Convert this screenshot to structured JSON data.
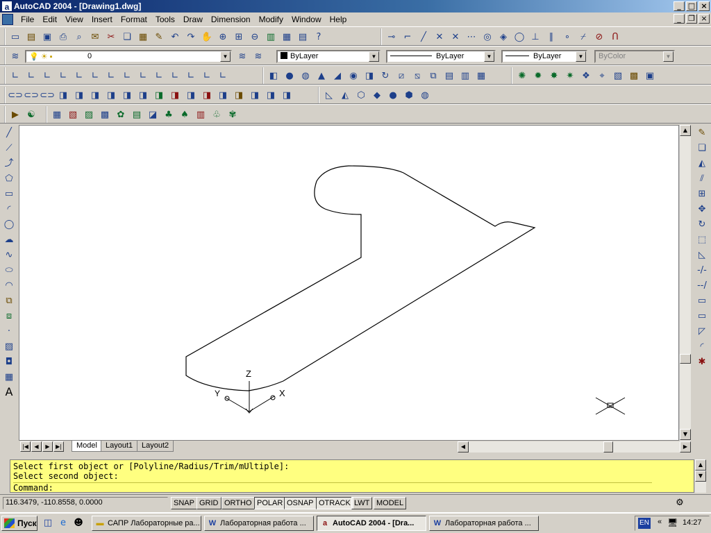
{
  "window": {
    "title": "AutoCAD 2004 - [Drawing1.dwg]",
    "app_icon": "a"
  },
  "menu": [
    "File",
    "Edit",
    "View",
    "Insert",
    "Format",
    "Tools",
    "Draw",
    "Dimension",
    "Modify",
    "Window",
    "Help"
  ],
  "properties": {
    "layer": "0",
    "color": "ByLayer",
    "linetype": "ByLayer",
    "lineweight": "ByLayer",
    "plotstyle": "ByColor"
  },
  "ucs": {
    "z": "Z",
    "y": "Y",
    "x": "X"
  },
  "tabs": [
    "Model",
    "Layout1",
    "Layout2"
  ],
  "command": {
    "line1": "Select first object or [Polyline/Radius/Trim/mUltiple]:",
    "line2": "Select second object:",
    "prompt": "Command:"
  },
  "status": {
    "coords": "116.3479, -110.8558, 0.0000",
    "modes": [
      "SNAP",
      "GRID",
      "ORTHO",
      "POLAR",
      "OSNAP",
      "OTRACK",
      "LWT",
      "MODEL"
    ]
  },
  "taskbar": {
    "start": "Пуск",
    "tasks": [
      "САПР Лабораторные ра...",
      "Лабораторная работа ...",
      "AutoCAD 2004 - [Dra...",
      "Лабораторная работа ..."
    ],
    "lang": "EN",
    "clock": "14:27"
  }
}
